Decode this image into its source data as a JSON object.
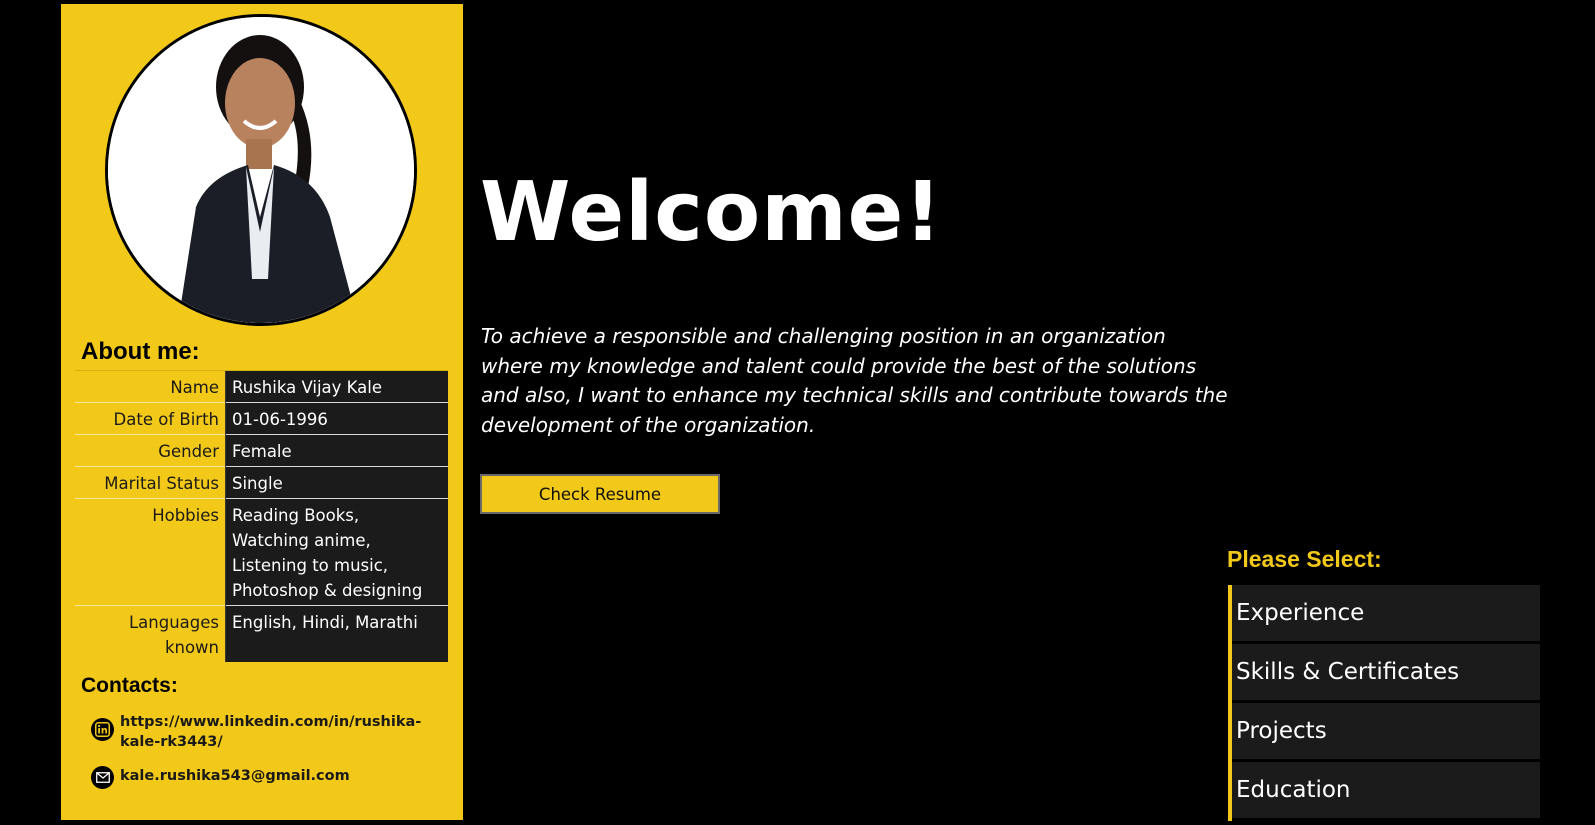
{
  "sidebar": {
    "about_heading": "About me:",
    "about_rows": [
      {
        "label": "Name",
        "value": "Rushika Vijay Kale"
      },
      {
        "label": "Date of Birth",
        "value": "01-06-1996"
      },
      {
        "label": "Gender",
        "value": "Female"
      },
      {
        "label": "Marital Status",
        "value": "Single"
      },
      {
        "label": "Hobbies",
        "value_lines": [
          "Reading Books,",
          "Watching anime,",
          "Listening to music,",
          "Photoshop & designing"
        ]
      },
      {
        "label": "Languages known",
        "value": "English, Hindi, Marathi"
      }
    ],
    "contacts_heading": "Contacts:",
    "contacts": {
      "linkedin": "https://www.linkedin.com/in/rushika-kale-rk3443/",
      "email": "kale.rushika543@gmail.com"
    }
  },
  "main": {
    "welcome": "Welcome!",
    "objective": "To achieve a responsible and challenging position in an organization where my knowledge and talent could provide the best of the solutions and also, I want to enhance my technical skills and contribute towards the development of the organization.",
    "resume_button": "Check Resume"
  },
  "menu": {
    "heading": "Please Select:",
    "items": [
      "Experience",
      "Skills & Certificates",
      "Projects",
      "Education"
    ]
  },
  "colors": {
    "accent": "#f2c819",
    "background": "#000000",
    "panel": "#1b1b1b"
  },
  "icons": {
    "linkedin": "linkedin-icon",
    "email": "mail-icon"
  }
}
